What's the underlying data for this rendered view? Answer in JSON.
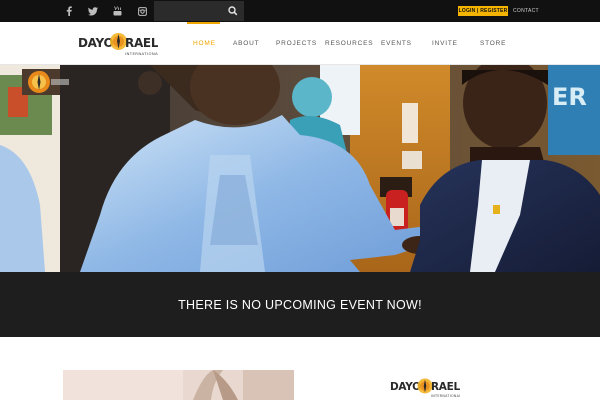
{
  "topbar": {
    "social": [
      "facebook-icon",
      "twitter-icon",
      "youtube-icon",
      "instagram-icon"
    ],
    "search": {
      "placeholder": "",
      "value": ""
    },
    "login_label": "LOGIN | REGISTER",
    "contact_label": "CONTACT"
  },
  "header": {
    "logo_text": "DAYO ISRAEL",
    "logo_sub": "INTERNATIONAL",
    "nav": [
      {
        "label": "HOME",
        "active": true
      },
      {
        "label": "ABOUT"
      },
      {
        "label": "PROJECTS"
      },
      {
        "label": "RESOURCES"
      },
      {
        "label": "EVENTS"
      },
      {
        "label": "INVITE"
      },
      {
        "label": "STORE"
      }
    ]
  },
  "event": {
    "message": "THERE IS NO UPCOMING EVENT NOW!"
  },
  "colors": {
    "accent": "#f0a500",
    "topbar": "#111111",
    "event_band": "#1e1e1e",
    "login_button": "#f5b400"
  }
}
